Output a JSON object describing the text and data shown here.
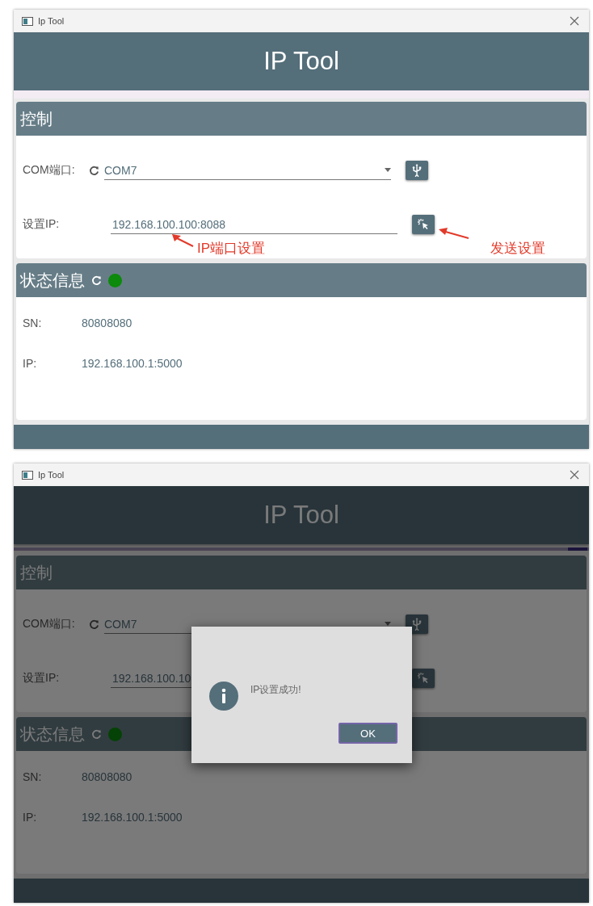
{
  "windows": [
    {
      "title": "Ip Tool",
      "heading": "IP Tool",
      "dimmed": false,
      "busy": false,
      "control": {
        "title": "控制",
        "com_label": "COM端口:",
        "com_value": "COM7",
        "ip_label": "设置IP:",
        "ip_value": "192.168.100.100:8088"
      },
      "status": {
        "title": "状态信息",
        "connected": true,
        "rows": [
          {
            "label": "SN:",
            "value": "80808080"
          },
          {
            "label": "IP:",
            "value": "192.168.100.1:5000"
          }
        ]
      },
      "annotations": [
        {
          "kind": "field",
          "text": "IP端口设置"
        },
        {
          "kind": "button",
          "text": "发送设置"
        }
      ]
    },
    {
      "title": "Ip Tool",
      "heading": "IP Tool",
      "dimmed": true,
      "busy": true,
      "control": {
        "title": "控制",
        "com_label": "COM端口:",
        "com_value": "COM7",
        "ip_label": "设置IP:",
        "ip_value": "192.168.100.10"
      },
      "status": {
        "title": "状态信息",
        "connected": true,
        "rows": [
          {
            "label": "SN:",
            "value": "80808080"
          },
          {
            "label": "IP:",
            "value": "192.168.100.1:5000"
          }
        ]
      },
      "dialog": {
        "message": "IP设置成功!",
        "button": "OK"
      }
    }
  ]
}
